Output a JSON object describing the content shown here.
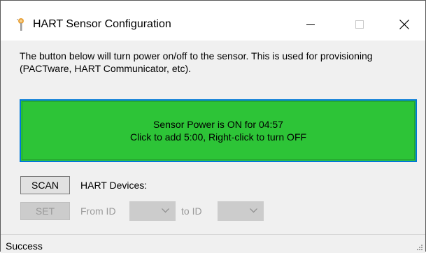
{
  "window": {
    "title": "HART Sensor Configuration",
    "icon": "sensor-probe-icon"
  },
  "description": "The button below will turn power on/off to the sensor. This is used for provisioning (PACTware, HART Communicator, etc).",
  "power_button": {
    "line1": "Sensor Power is ON for 04:57",
    "line2": "Click to add 5:00, Right-click to turn OFF",
    "color": "#2dc437",
    "focus_border": "#0078d7"
  },
  "scan": {
    "button_label": "SCAN",
    "devices_label": "HART Devices:"
  },
  "set": {
    "button_label": "SET",
    "from_label": "From ID",
    "to_label": "to ID",
    "from_value": "",
    "to_value": ""
  },
  "status": {
    "text": "Success"
  }
}
